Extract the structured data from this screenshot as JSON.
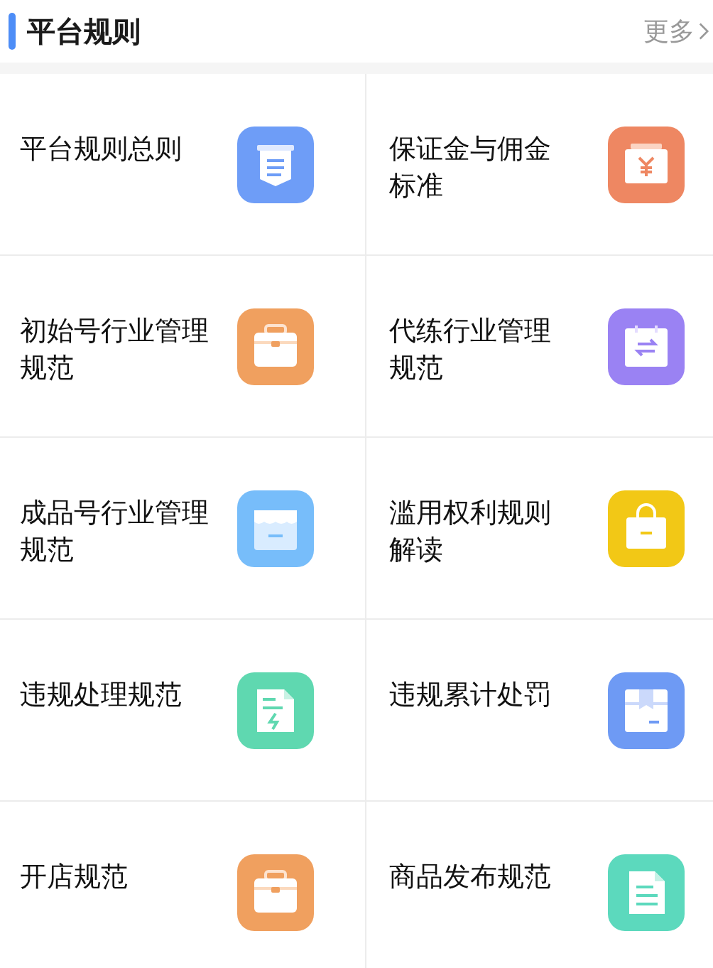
{
  "header": {
    "title": "平台规则",
    "more": "更多"
  },
  "items": [
    {
      "label": "平台规则总则",
      "kind": "document",
      "color": "#6e9df7"
    },
    {
      "label": "保证金与佣金标准",
      "kind": "money",
      "color": "#ee8762"
    },
    {
      "label": "初始号行业管理规范",
      "kind": "briefcase",
      "color": "#f0a05f"
    },
    {
      "label": "代练行业管理规范",
      "kind": "swap",
      "color": "#9a82f3"
    },
    {
      "label": "成品号行业管理规范",
      "kind": "store",
      "color": "#77bdfa"
    },
    {
      "label": "滥用权利规则解读",
      "kind": "bag",
      "color": "#f2c816"
    },
    {
      "label": "违规处理规范",
      "kind": "bolt",
      "color": "#5fd8b0"
    },
    {
      "label": "违规累计处罚",
      "kind": "box",
      "color": "#6e9af4"
    },
    {
      "label": "开店规范",
      "kind": "briefcase",
      "color": "#f0a05f"
    },
    {
      "label": "商品发布规范",
      "kind": "file",
      "color": "#5cd9bd"
    }
  ]
}
